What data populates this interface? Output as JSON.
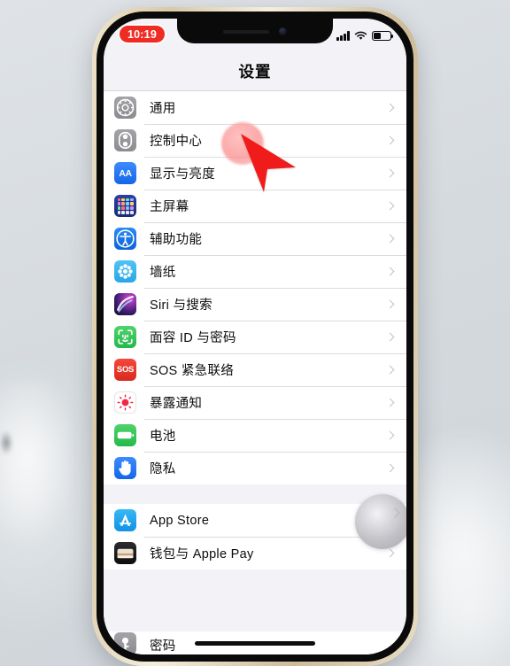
{
  "device": {
    "frame_color": "#e0cfae",
    "bezel_color": "#0a0a0a",
    "background_color": "#d7dce1"
  },
  "status_bar": {
    "time": "10:19",
    "recording_pill_color": "#ef2b24",
    "signal_icon": "cellular-bars-icon",
    "wifi_icon": "wifi-icon",
    "battery_icon": "battery-icon",
    "battery_level_percent": 42
  },
  "nav": {
    "title": "设置"
  },
  "groups": [
    {
      "id": "group-system",
      "rows": [
        {
          "label": "通用",
          "icon": "gear-icon",
          "icon_class": "ic-gear"
        },
        {
          "label": "控制中心",
          "icon": "control-center-icon",
          "icon_class": "ic-cc"
        },
        {
          "label": "显示与亮度",
          "icon": "display-brightness-icon",
          "icon_class": "ic-aa",
          "glyph_text": "AA"
        },
        {
          "label": "主屏幕",
          "icon": "home-screen-icon",
          "icon_class": "ic-home"
        },
        {
          "label": "辅助功能",
          "icon": "accessibility-icon",
          "icon_class": "ic-acc"
        },
        {
          "label": "墙纸",
          "icon": "wallpaper-icon",
          "icon_class": "ic-wall"
        },
        {
          "label": "Siri 与搜索",
          "icon": "siri-icon",
          "icon_class": "ic-siri"
        },
        {
          "label": "面容 ID 与密码",
          "icon": "face-id-icon",
          "icon_class": "ic-face"
        },
        {
          "label": "SOS 紧急联络",
          "icon": "sos-icon",
          "icon_class": "ic-sos",
          "glyph_text": "SOS"
        },
        {
          "label": "暴露通知",
          "icon": "exposure-notification-icon",
          "icon_class": "ic-expo"
        },
        {
          "label": "电池",
          "icon": "battery-settings-icon",
          "icon_class": "ic-batt"
        },
        {
          "label": "隐私",
          "icon": "privacy-hand-icon",
          "icon_class": "ic-priv"
        }
      ]
    },
    {
      "id": "group-store",
      "rows": [
        {
          "label": "App Store",
          "icon": "app-store-icon",
          "icon_class": "ic-appstore"
        },
        {
          "label": "钱包与 Apple Pay",
          "icon": "wallet-icon",
          "icon_class": "ic-wallet"
        }
      ]
    }
  ],
  "partial_row": {
    "label": "密码",
    "icon": "passwords-key-icon",
    "icon_class": "ic-pass"
  },
  "overlays": {
    "assistive_touch": "assistive-touch-button",
    "cursor": "red-arrow-cursor",
    "tap_highlight": "tap-highlight-circle",
    "cursor_color": "#f01c1c",
    "home_indicator": "home-indicator"
  }
}
